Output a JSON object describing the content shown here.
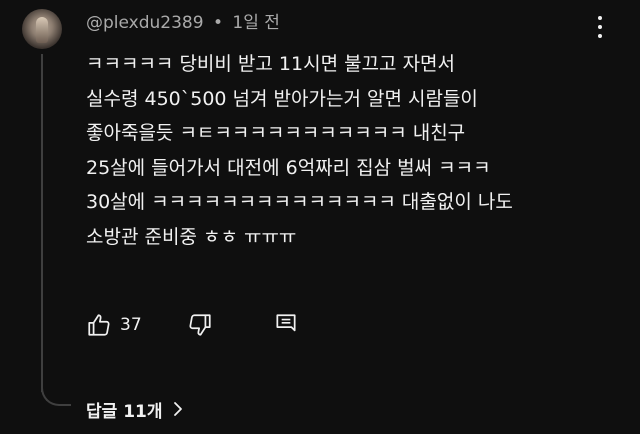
{
  "comment": {
    "author": "@plexdu2389",
    "separator": "•",
    "timestamp": "1일 전",
    "lines": [
      "ㅋㅋㅋㅋㅋ 당비비 받고 11시면 불끄고 자면서",
      "실수령 450`500 넘겨 받아가는거 알면 시람들이",
      "좋아죽을듯 ㅋㅌㅋㅋㅋㅋㅋㅋㅋㅋㅋㅋㅋ 내친구",
      "25살에 들어가서 대전에 6억짜리 집삼 벌써 ㅋㅋㅋ",
      "30살에 ㅋㅋㅋㅋㅋㅋㅋㅋㅋㅋㅋㅋㅋㅋ 대출없이 나도",
      "소방관 준비중 ㅎㅎ ㅠㅠㅠ"
    ]
  },
  "actions": {
    "like_icon": "thumbs-up-icon",
    "like_count": "37",
    "dislike_icon": "thumbs-down-icon",
    "reply_icon": "reply-comment-icon"
  },
  "replies": {
    "label": "답글 11개",
    "chevron_icon": "chevron-right-icon"
  },
  "colors": {
    "background": "#0f0f0f",
    "text_primary": "#f1f1f1",
    "text_secondary": "#aaaaaa",
    "thread_line": "#3f3f3f"
  }
}
